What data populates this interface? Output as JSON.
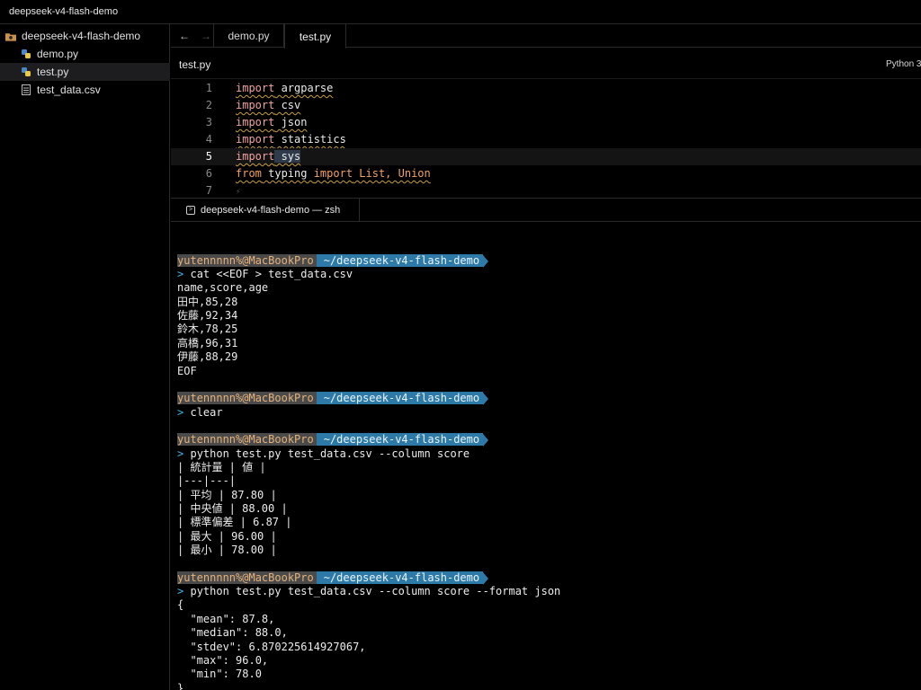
{
  "window": {
    "title": "deepseek-v4-flash-demo"
  },
  "sidebar": {
    "folder": "deepseek-v4-flash-demo",
    "files": [
      {
        "name": "demo.py",
        "icon": "python-file-icon"
      },
      {
        "name": "test.py",
        "icon": "python-file-icon",
        "selected": true
      },
      {
        "name": "test_data.csv",
        "icon": "text-file-icon"
      }
    ]
  },
  "editor": {
    "nav": {
      "back": "←",
      "forward": "→"
    },
    "tabs": [
      {
        "label": "demo.py"
      },
      {
        "label": "test.py",
        "active": true
      }
    ],
    "filename": "test.py",
    "language": "Python 3",
    "lines": [
      {
        "num": "1",
        "kw": "import",
        "rest": " argparse"
      },
      {
        "num": "2",
        "kw": "import",
        "rest": " csv"
      },
      {
        "num": "3",
        "kw": "import",
        "rest": " json"
      },
      {
        "num": "4",
        "kw": "import",
        "rest": " statistics"
      },
      {
        "num": "5",
        "kw": "import",
        "rest": " sys"
      },
      {
        "num": "6",
        "kw": "from",
        "mid": " typing ",
        "kw2": "import",
        "rest": " List, Union"
      },
      {
        "num": "7",
        "hint": "⚡"
      }
    ],
    "current_line": 5
  },
  "terminal": {
    "tab_label": "deepseek-v4-flash-demo — zsh",
    "prompt_user": "yutennnnn%@MacBookPro",
    "prompt_path": "~/deepseek-v4-flash-demo",
    "caret": ">",
    "blocks": [
      {
        "cmd": "cat <<EOF > test_data.csv",
        "output": [
          "name,score,age",
          "田中,85,28",
          "佐藤,92,34",
          "鈴木,78,25",
          "高橋,96,31",
          "伊藤,88,29",
          "EOF"
        ]
      },
      {
        "cmd": "clear",
        "output": []
      },
      {
        "cmd": "python test.py test_data.csv --column score",
        "output": [
          "| 統計量 | 値 |",
          "|---|---|",
          "| 平均 | 87.80 |",
          "| 中央値 | 88.00 |",
          "| 標準偏差 | 6.87 |",
          "| 最大 | 96.00 |",
          "| 最小 | 78.00 |"
        ]
      },
      {
        "cmd": "python test.py test_data.csv --column score --format json",
        "output": [
          "{",
          "  \"mean\": 87.8,",
          "  \"median\": 88.0,",
          "  \"stdev\": 6.870225614927067,",
          "  \"max\": 96.0,",
          "  \"min\": 78.0",
          "}"
        ]
      }
    ]
  }
}
